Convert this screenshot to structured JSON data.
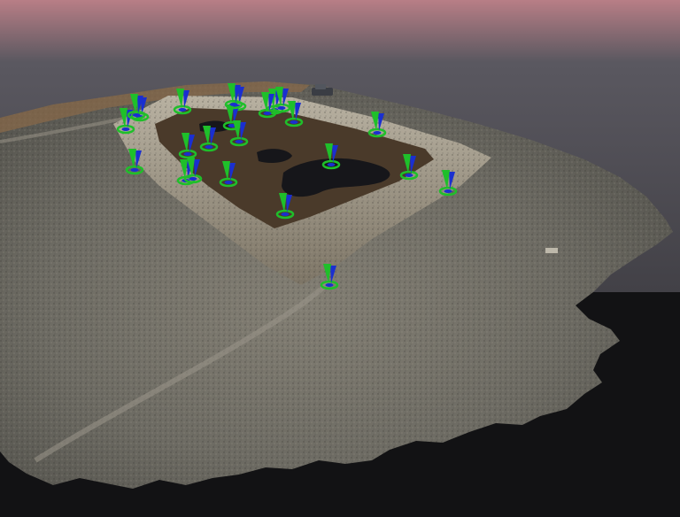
{
  "viewport": {
    "sky_top_color": "#b87e86",
    "sky_mid_color": "#5a5860",
    "sky_bottom_color": "#2b2a2e",
    "ground_color": "#6d6b63",
    "pit_floor_color": "#4a3a2a",
    "water_color": "#16161a",
    "marker_green_color": "#1fbf2a",
    "marker_blue_color": "#1a2fd0",
    "marker_count": 24
  },
  "icons": {
    "marker": "ground-control-point-icon",
    "vehicle": "vehicle-icon"
  }
}
